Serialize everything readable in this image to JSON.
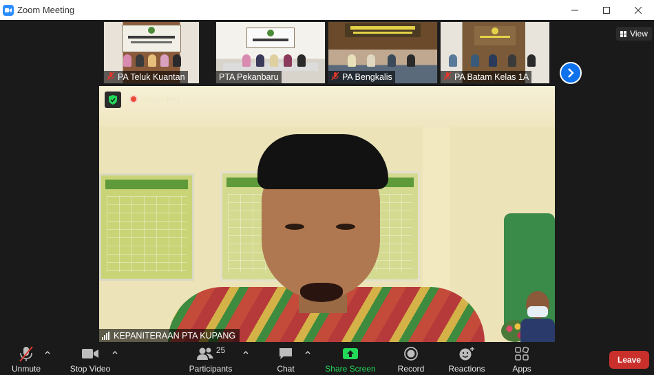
{
  "window": {
    "title": "Zoom Meeting",
    "controls": [
      "minimize",
      "maximize",
      "close"
    ]
  },
  "gallery": {
    "view_label": "View",
    "participants": [
      {
        "name": "PA Teluk Kuantan",
        "muted": true,
        "banner_text": "MEDIA CENTER"
      },
      {
        "name": "PTA Pekanbaru",
        "muted": false,
        "banner_text": ""
      },
      {
        "name": "PA Bengkalis",
        "muted": true,
        "banner_text": "MEDIA CENTER"
      },
      {
        "name": "PA Batam Kelas 1A",
        "muted": true,
        "banner_text": "MEDIA CENTER"
      }
    ],
    "next_icon": "chevron-right-icon"
  },
  "active_speaker": {
    "name": "KEPANITERAAN PTA KUPANG",
    "recording_label": "Recording",
    "security_icon": "shield-check-icon"
  },
  "toolbar": {
    "unmute_label": "Unmute",
    "stop_video_label": "Stop Video",
    "participants_label": "Participants",
    "participants_count": "25",
    "chat_label": "Chat",
    "share_screen_label": "Share Screen",
    "record_label": "Record",
    "reactions_label": "Reactions",
    "apps_label": "Apps",
    "leave_label": "Leave"
  },
  "colors": {
    "accent": "#0e72ed",
    "share_green": "#23d959",
    "leave_red": "#c9302c",
    "mute_red": "#e0382c"
  }
}
